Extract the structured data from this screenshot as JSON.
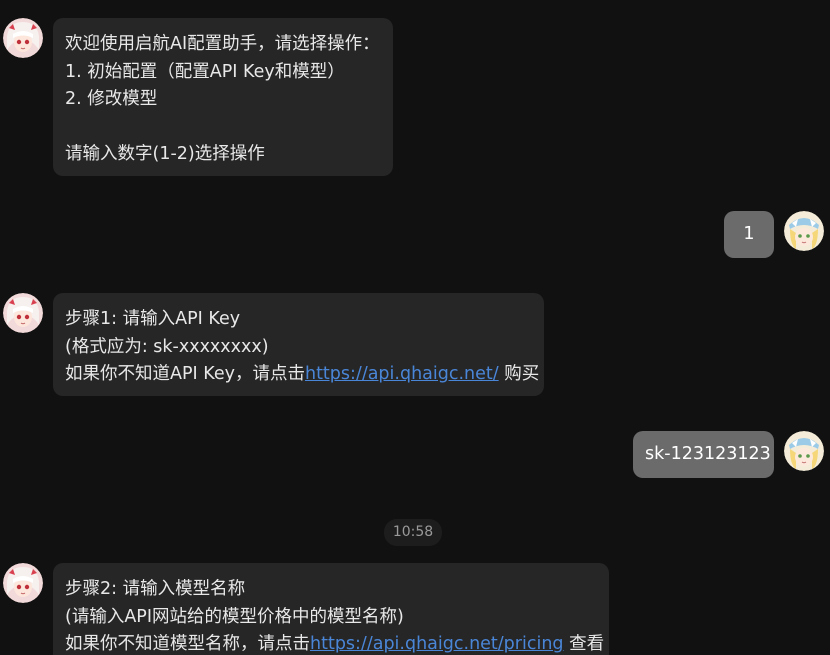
{
  "messages": [
    {
      "sender": "bot",
      "lines": [
        "欢迎使用启航AI配置助手，请选择操作：",
        "1. 初始配置（配置API Key和模型）",
        "2. 修改模型",
        "",
        "请输入数字(1-2)选择操作"
      ]
    },
    {
      "sender": "user",
      "text": "1"
    },
    {
      "sender": "bot",
      "lines": [
        "步骤1: 请输入API Key",
        "(格式应为: sk-xxxxxxxx)"
      ],
      "link_line": {
        "prefix": "如果你不知道API Key，请点击",
        "link": "https://api.qhaigc.net/",
        "suffix": " 购买"
      }
    },
    {
      "sender": "user",
      "text": "sk-123123123"
    },
    {
      "sender": "bot",
      "lines": [
        "步骤2: 请输入模型名称",
        "(请输入API网站给的模型价格中的模型名称)"
      ],
      "link_line": {
        "prefix": "如果你不知道模型名称，请点击",
        "link": "https://api.qhaigc.net/pricing",
        "suffix": " 查看"
      }
    }
  ],
  "timestamp": "10:58",
  "colors": {
    "background": "#111111",
    "bot_bubble": "#262626",
    "user_bubble": "#6b6b6b",
    "link": "#4a86d8"
  },
  "icons": {
    "bot_avatar": "anime-girl-avatar-icon",
    "user_avatar": "anime-girl-blue-hat-avatar-icon"
  }
}
